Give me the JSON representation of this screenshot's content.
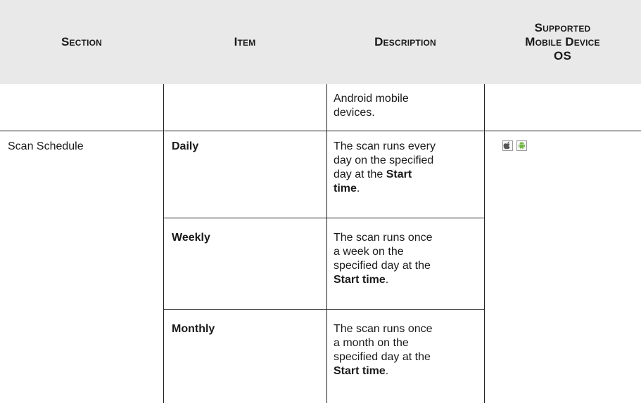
{
  "headers": {
    "section": "Section",
    "item": "Item",
    "description": "Description",
    "os_line1": "Supported",
    "os_line2": "Mobile Device",
    "os_line3": "OS"
  },
  "rows": [
    {
      "section": "",
      "item": "",
      "description_lines": [
        "Android mobile",
        "devices."
      ]
    },
    {
      "section": "Scan Schedule",
      "item": "Daily",
      "description": {
        "line1": "The scan runs every",
        "line2": "day on the specified",
        "line3_prefix": "day at the ",
        "line3_bold": "Start",
        "line4_bold": "time",
        "line4_suffix": "."
      },
      "os_icons": [
        "apple-icon",
        "android-icon"
      ]
    },
    {
      "item": "Weekly",
      "description": {
        "line1": "The scan runs once",
        "line2": "a week on the",
        "line3": "specified day at the",
        "line4_bold": "Start time",
        "line4_suffix": "."
      }
    },
    {
      "item": "Monthly",
      "description": {
        "line1": "The scan runs once",
        "line2": "a month on the",
        "line3": "specified day at the",
        "line4_bold": "Start time",
        "line4_suffix": "."
      }
    }
  ],
  "colors": {
    "header_bg": "#e9e9e9",
    "android": "#6fb43f",
    "apple": "#555555"
  }
}
